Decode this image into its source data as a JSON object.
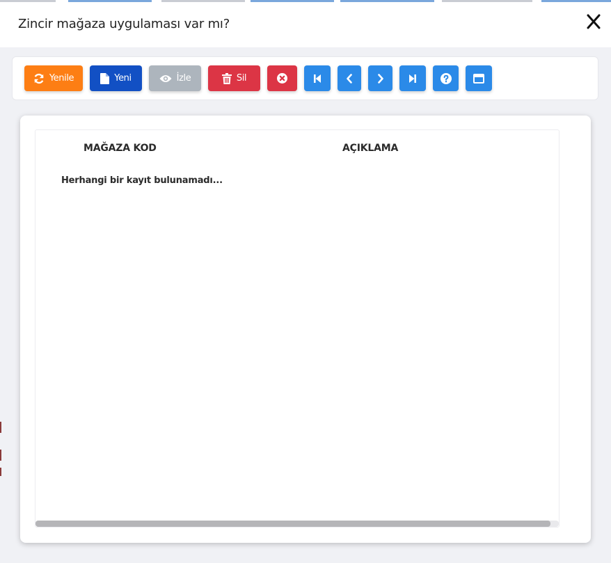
{
  "dialog": {
    "title": "Zincir mağaza uygulaması var mı?",
    "close_icon": "close-icon"
  },
  "toolbar": {
    "refresh": {
      "label": "Yenile",
      "icon": "refresh-icon",
      "color": "#fd7e14"
    },
    "new": {
      "label": "Yeni",
      "icon": "file-icon",
      "color": "#1250c4"
    },
    "view": {
      "label": "İzle",
      "icon": "eye-icon",
      "color": "#adb5bd"
    },
    "delete": {
      "label": "Sil",
      "icon": "trash-icon",
      "color": "#dc3545"
    },
    "cancel": {
      "icon": "times-circle-icon",
      "color": "#dc3545"
    },
    "first": {
      "icon": "first-record-icon",
      "color": "#2b8ae8"
    },
    "prev": {
      "icon": "chevron-left-icon",
      "color": "#2b8ae8"
    },
    "next": {
      "icon": "chevron-right-icon",
      "color": "#2b8ae8"
    },
    "last": {
      "icon": "last-record-icon",
      "color": "#2b8ae8"
    },
    "help": {
      "icon": "question-circle-icon",
      "color": "#2b8ae8"
    },
    "window": {
      "icon": "window-icon",
      "color": "#2b8ae8"
    }
  },
  "grid": {
    "columns": [
      "MAĞAZA KOD",
      "AÇIKLAMA"
    ],
    "empty_message": "Herhangi bir kayıt bulunamadı..."
  }
}
